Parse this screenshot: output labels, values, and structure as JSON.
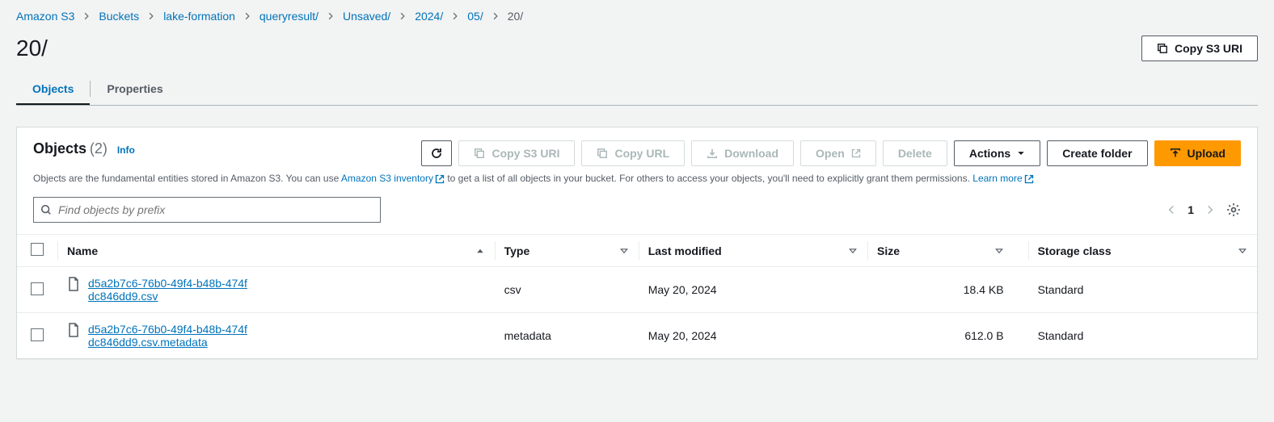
{
  "breadcrumbs": [
    {
      "label": "Amazon S3",
      "link": true
    },
    {
      "label": "Buckets",
      "link": true
    },
    {
      "label": "lake-formation",
      "link": true
    },
    {
      "label": "queryresult/",
      "link": true
    },
    {
      "label": "Unsaved/",
      "link": true
    },
    {
      "label": "2024/",
      "link": true
    },
    {
      "label": "05/",
      "link": true
    },
    {
      "label": "20/",
      "link": false
    }
  ],
  "page_title": "20/",
  "copy_uri_button": "Copy S3 URI",
  "tabs": {
    "objects": "Objects",
    "properties": "Properties"
  },
  "panel": {
    "title": "Objects",
    "count_text": "(2)",
    "info_label": "Info",
    "desc_pre": "Objects are the fundamental entities stored in Amazon S3. You can use ",
    "desc_link1": "Amazon S3 inventory",
    "desc_mid": " to get a list of all objects in your bucket. For others to access your objects, you'll need to explicitly grant them permissions. ",
    "desc_link2": "Learn more"
  },
  "toolbar": {
    "copy_s3_uri": "Copy S3 URI",
    "copy_url": "Copy URL",
    "download": "Download",
    "open": "Open",
    "delete": "Delete",
    "actions": "Actions",
    "create_folder": "Create folder",
    "upload": "Upload"
  },
  "search": {
    "placeholder": "Find objects by prefix"
  },
  "pager": {
    "page": "1"
  },
  "columns": {
    "name": "Name",
    "type": "Type",
    "last_modified": "Last modified",
    "size": "Size",
    "storage_class": "Storage class"
  },
  "rows": [
    {
      "name": "d5a2b7c6-76b0-49f4-b48b-474fdc846dd9.csv",
      "type": "csv",
      "last_modified": "May 20, 2024",
      "size": "18.4 KB",
      "storage_class": "Standard"
    },
    {
      "name": "d5a2b7c6-76b0-49f4-b48b-474fdc846dd9.csv.metadata",
      "type": "metadata",
      "last_modified": "May 20, 2024",
      "size": "612.0 B",
      "storage_class": "Standard"
    }
  ]
}
